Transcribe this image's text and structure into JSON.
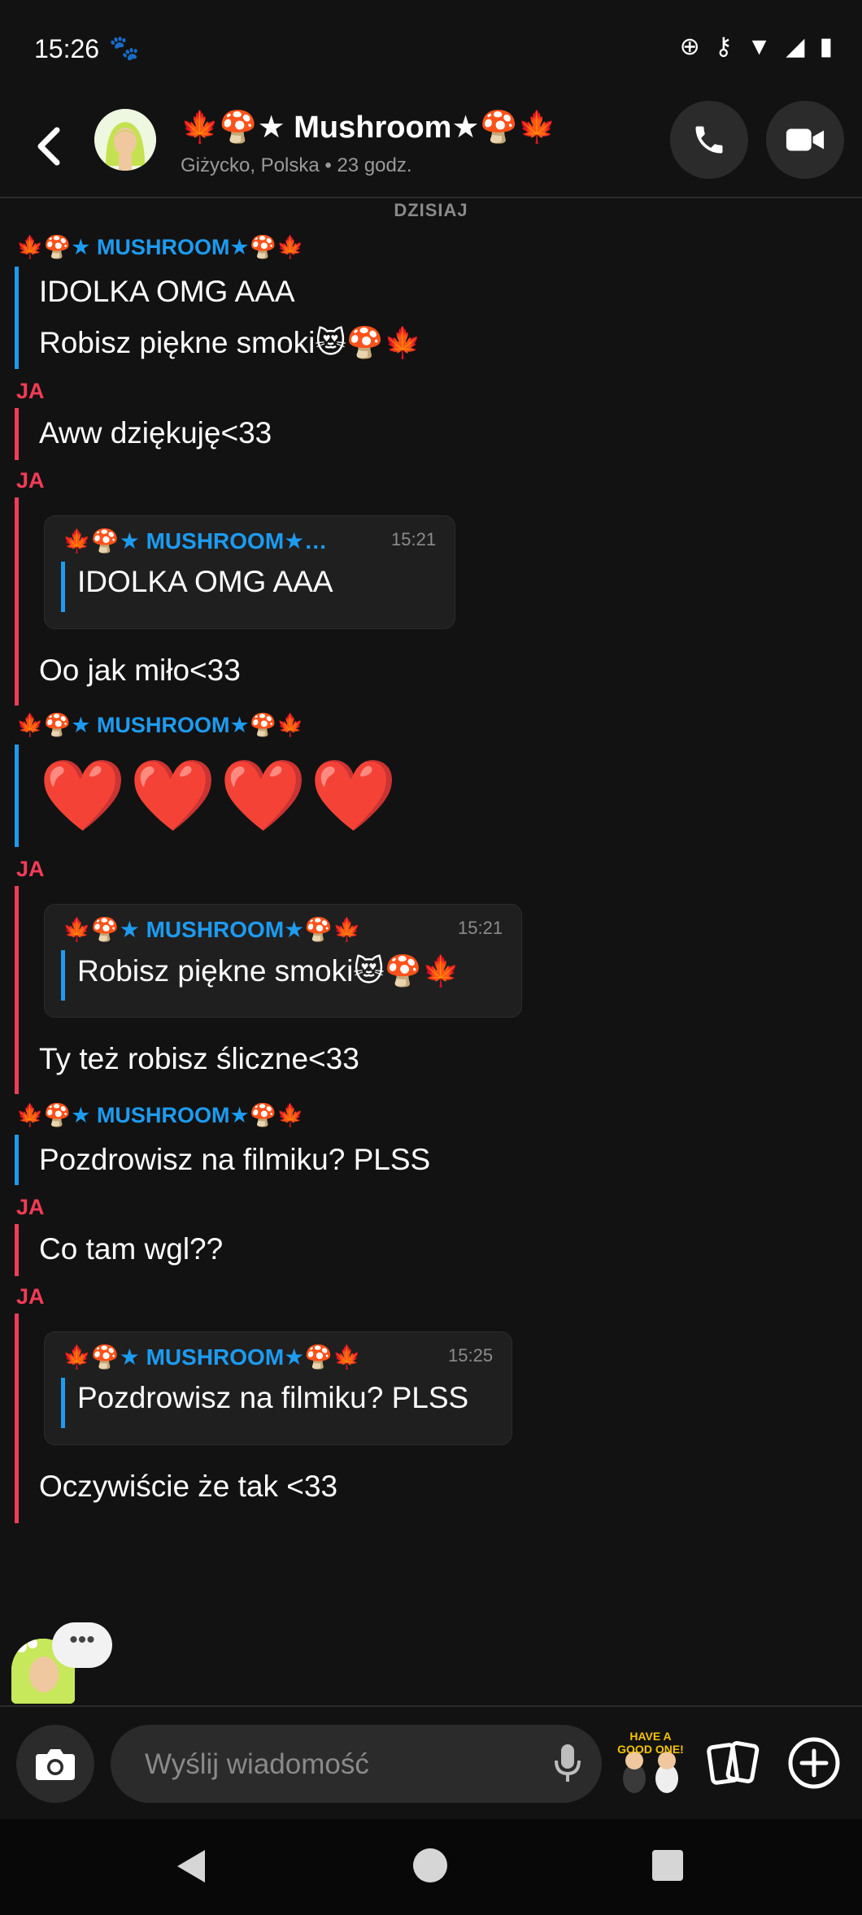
{
  "status_bar": {
    "time": "15:26",
    "paw_icon": "🐾",
    "icons": [
      "⊕",
      "⚷",
      "▼",
      "◢",
      "▮"
    ]
  },
  "header": {
    "back_icon": "chevron-left",
    "title": "🍁🍄★ Mushroom★🍄🍁",
    "subtitle": "Giżycko, Polska • 23 godz.",
    "call_icon": "phone",
    "video_icon": "video-camera"
  },
  "day_label": "DZISIAJ",
  "messages": [
    {
      "sender": "🍁🍄★ MUSHROOM★🍄🍁",
      "lines": [
        "IDOLKA OMG AAA",
        "Robisz piękne smoki😻🍄🍁"
      ]
    },
    {
      "sender": "JA",
      "lines": [
        "Aww dziękuję<33"
      ]
    },
    {
      "sender": "JA",
      "quote": {
        "sender": "🍁🍄★ MUSHROOM★…",
        "time": "15:21",
        "text": "IDOLKA OMG AAA"
      },
      "lines": [
        "Oo jak miło<33"
      ]
    },
    {
      "sender": "🍁🍄★ MUSHROOM★🍄🍁",
      "lines": [
        "❤️❤️❤️❤️"
      ]
    },
    {
      "sender": "JA",
      "quote": {
        "sender": "🍁🍄★ MUSHROOM★🍄🍁",
        "time": "15:21",
        "text": "Robisz piękne smoki😻🍄🍁"
      },
      "lines": [
        "Ty też robisz śliczne<33"
      ]
    },
    {
      "sender": "🍁🍄★ MUSHROOM★🍄🍁",
      "lines": [
        "Pozdrowisz na filmiku? PLSS"
      ]
    },
    {
      "sender": "JA",
      "lines": [
        "Co tam wgl??"
      ]
    },
    {
      "sender": "JA",
      "quote": {
        "sender": "🍁🍄★ MUSHROOM★🍄🍁",
        "time": "15:25",
        "text": "Pozdrowisz na filmiku? PLSS"
      },
      "lines": [
        "Oczywiście że tak <33"
      ]
    }
  ],
  "typing_indicator": "•••",
  "composer": {
    "placeholder": "Wyślij wiadomość",
    "sticker_text": "HAVE A GOOD ONE!"
  },
  "colors": {
    "background": "#121212",
    "them_accent": "#1d9bf0",
    "me_accent": "#f23c57"
  }
}
